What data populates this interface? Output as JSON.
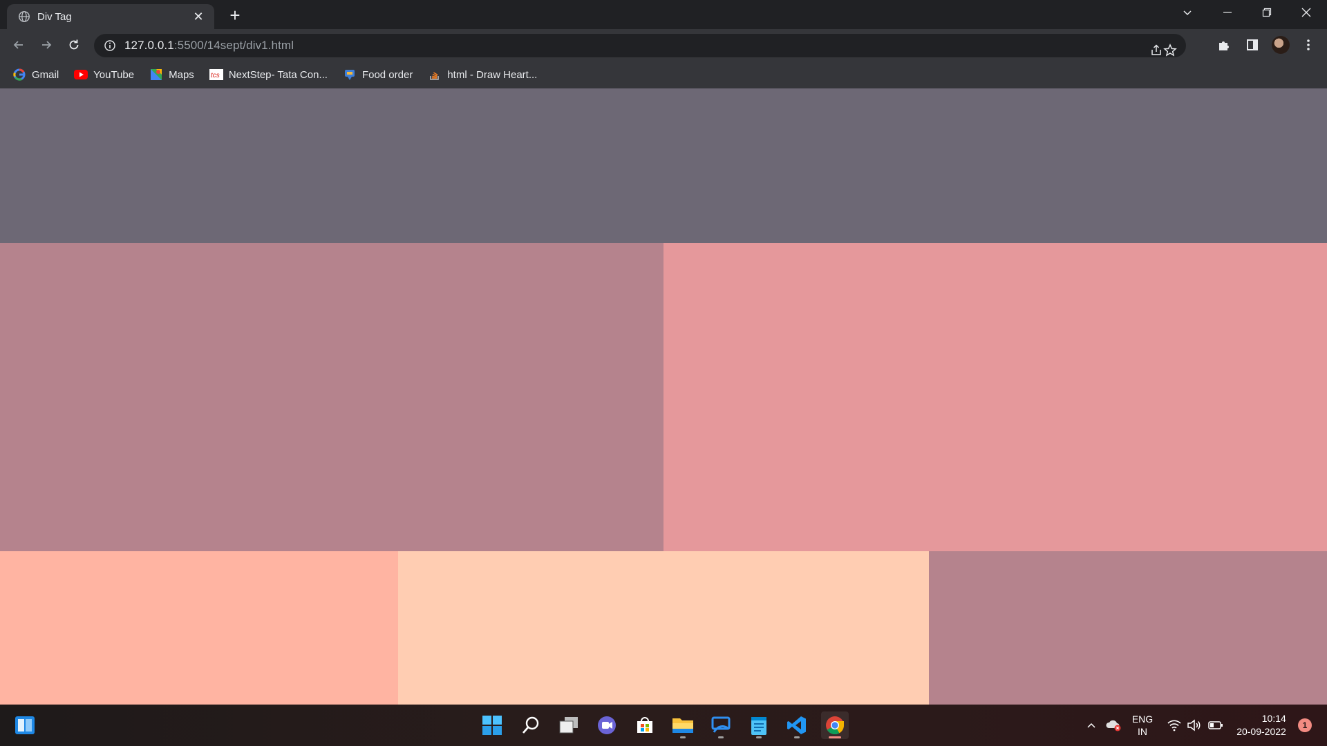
{
  "browser": {
    "tab": {
      "title": "Div Tag"
    },
    "address": {
      "host": "127.0.0.1",
      "rest": ":5500/14sept/div1.html"
    },
    "bookmarks": [
      {
        "label": "Gmail",
        "icon": "google-icon"
      },
      {
        "label": "YouTube",
        "icon": "youtube-icon"
      },
      {
        "label": "Maps",
        "icon": "maps-icon"
      },
      {
        "label": "NextStep- Tata Con...",
        "icon": "tcs-icon"
      },
      {
        "label": "Food order",
        "icon": "food-order-icon"
      },
      {
        "label": "html - Draw Heart...",
        "icon": "stackoverflow-icon"
      }
    ]
  },
  "page": {
    "blocks": [
      {
        "name": "top-block",
        "color": "#6d6875"
      },
      {
        "name": "middle-left-block",
        "color": "#b5838d"
      },
      {
        "name": "middle-right-block",
        "color": "#e5989b"
      },
      {
        "name": "bottom-left-block",
        "color": "#ffb4a2"
      },
      {
        "name": "bottom-center-block",
        "color": "#ffcdb2"
      },
      {
        "name": "bottom-right-block",
        "color": "#b5838d"
      }
    ]
  },
  "taskbar": {
    "apps": [
      "widgets-icon",
      "windows-start-icon",
      "search-icon",
      "task-view-icon",
      "teams-chat-icon",
      "microsoft-store-icon",
      "file-explorer-icon",
      "remote-desktop-icon",
      "notepad-icon",
      "vscode-icon",
      "chrome-icon"
    ],
    "language": {
      "line1": "ENG",
      "line2": "IN"
    },
    "time": "10:14",
    "date": "20-09-2022",
    "notification_count": "1"
  }
}
